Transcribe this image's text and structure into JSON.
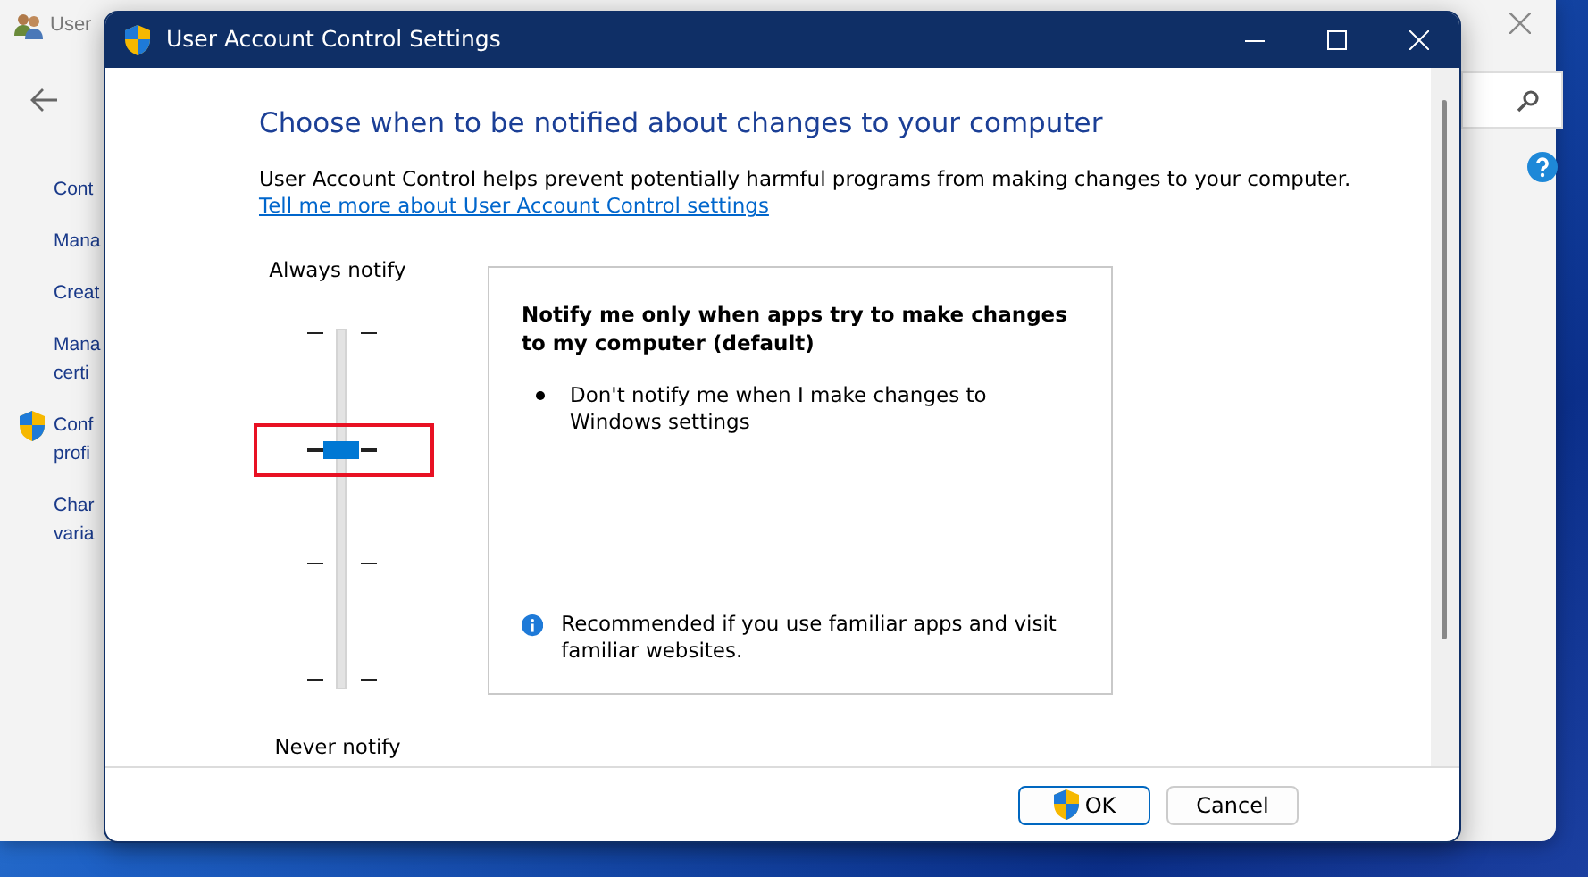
{
  "background_window": {
    "title": "User",
    "links": [
      {
        "text": "Cont",
        "kind": "plain"
      },
      {
        "text": "Mana",
        "kind": "plain"
      },
      {
        "text": "Creat",
        "kind": "plain"
      },
      {
        "text": "Mana\ncerti",
        "kind": "plain"
      },
      {
        "text": "Conf\nprofi",
        "kind": "shield"
      },
      {
        "text": "Char\nvaria",
        "kind": "plain"
      }
    ]
  },
  "dialog": {
    "title": "User Account Control Settings",
    "heading": "Choose when to be notified about changes to your computer",
    "description": "User Account Control helps prevent potentially harmful programs from making changes to your computer.",
    "link": "Tell me more about User Account Control settings",
    "slider": {
      "top_label": "Always notify",
      "bottom_label": "Never notify",
      "level": 0.667,
      "highlighted": true
    },
    "panel": {
      "title": "Notify me only when apps try to make changes to my computer (default)",
      "bullets": [
        "Don't notify me when I make changes to Windows settings"
      ],
      "note": "Recommended if you use familiar apps and visit familiar websites."
    },
    "buttons": [
      {
        "label": "OK",
        "kind": "default",
        "shield": true
      },
      {
        "label": "Cancel",
        "kind": "normal",
        "shield": false
      }
    ]
  }
}
